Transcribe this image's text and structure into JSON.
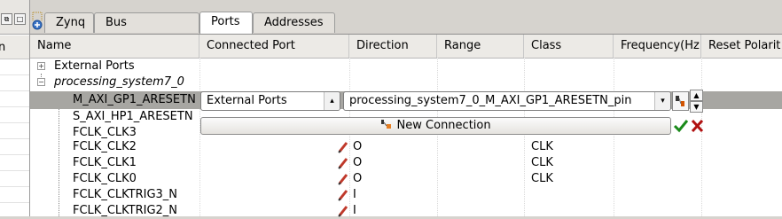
{
  "tabs": [
    {
      "label": "Zynq",
      "active": false
    },
    {
      "label": "Bus Interfaces",
      "active": false
    },
    {
      "label": "Ports",
      "active": true
    },
    {
      "label": "Addresses",
      "active": false
    }
  ],
  "left_panel": {
    "header_fragment": "n"
  },
  "columns": [
    "Name",
    "Connected Port",
    "Direction",
    "Range",
    "Class",
    "Frequency(Hz)",
    "Reset Polarit"
  ],
  "rows": [
    {
      "name": "External Ports",
      "italic": false,
      "group": true,
      "expanded": false,
      "direction": "",
      "class": ""
    },
    {
      "name": "processing_system7_0",
      "italic": true,
      "group": true,
      "expanded": true,
      "direction": "",
      "class": ""
    },
    {
      "name": "M_AXI_GP1_ARESETN",
      "selected": true,
      "direction": "",
      "class": ""
    },
    {
      "name": "S_AXI_HP1_ARESETN",
      "direction": "",
      "class": ""
    },
    {
      "name": "FCLK_CLK3",
      "direction": "",
      "class": ""
    },
    {
      "name": "FCLK_CLK2",
      "direction": "O",
      "class": "CLK",
      "pencil": true
    },
    {
      "name": "FCLK_CLK1",
      "direction": "O",
      "class": "CLK",
      "pencil": true
    },
    {
      "name": "FCLK_CLK0",
      "direction": "O",
      "class": "CLK",
      "pencil": true
    },
    {
      "name": "FCLK_CLKTRIG3_N",
      "direction": "I",
      "class": "",
      "pencil": true
    },
    {
      "name": "FCLK_CLKTRIG2_N",
      "direction": "I",
      "class": "",
      "pencil": true
    }
  ],
  "editor": {
    "source_combo": "External Ports",
    "port_combo": "processing_system7_0_M_AXI_GP1_ARESETN_pin",
    "new_connection_label": "New Connection"
  },
  "colors": {
    "selected_row": "#a7a6a2",
    "accept": "#1a8a1a",
    "cancel": "#b01010"
  }
}
